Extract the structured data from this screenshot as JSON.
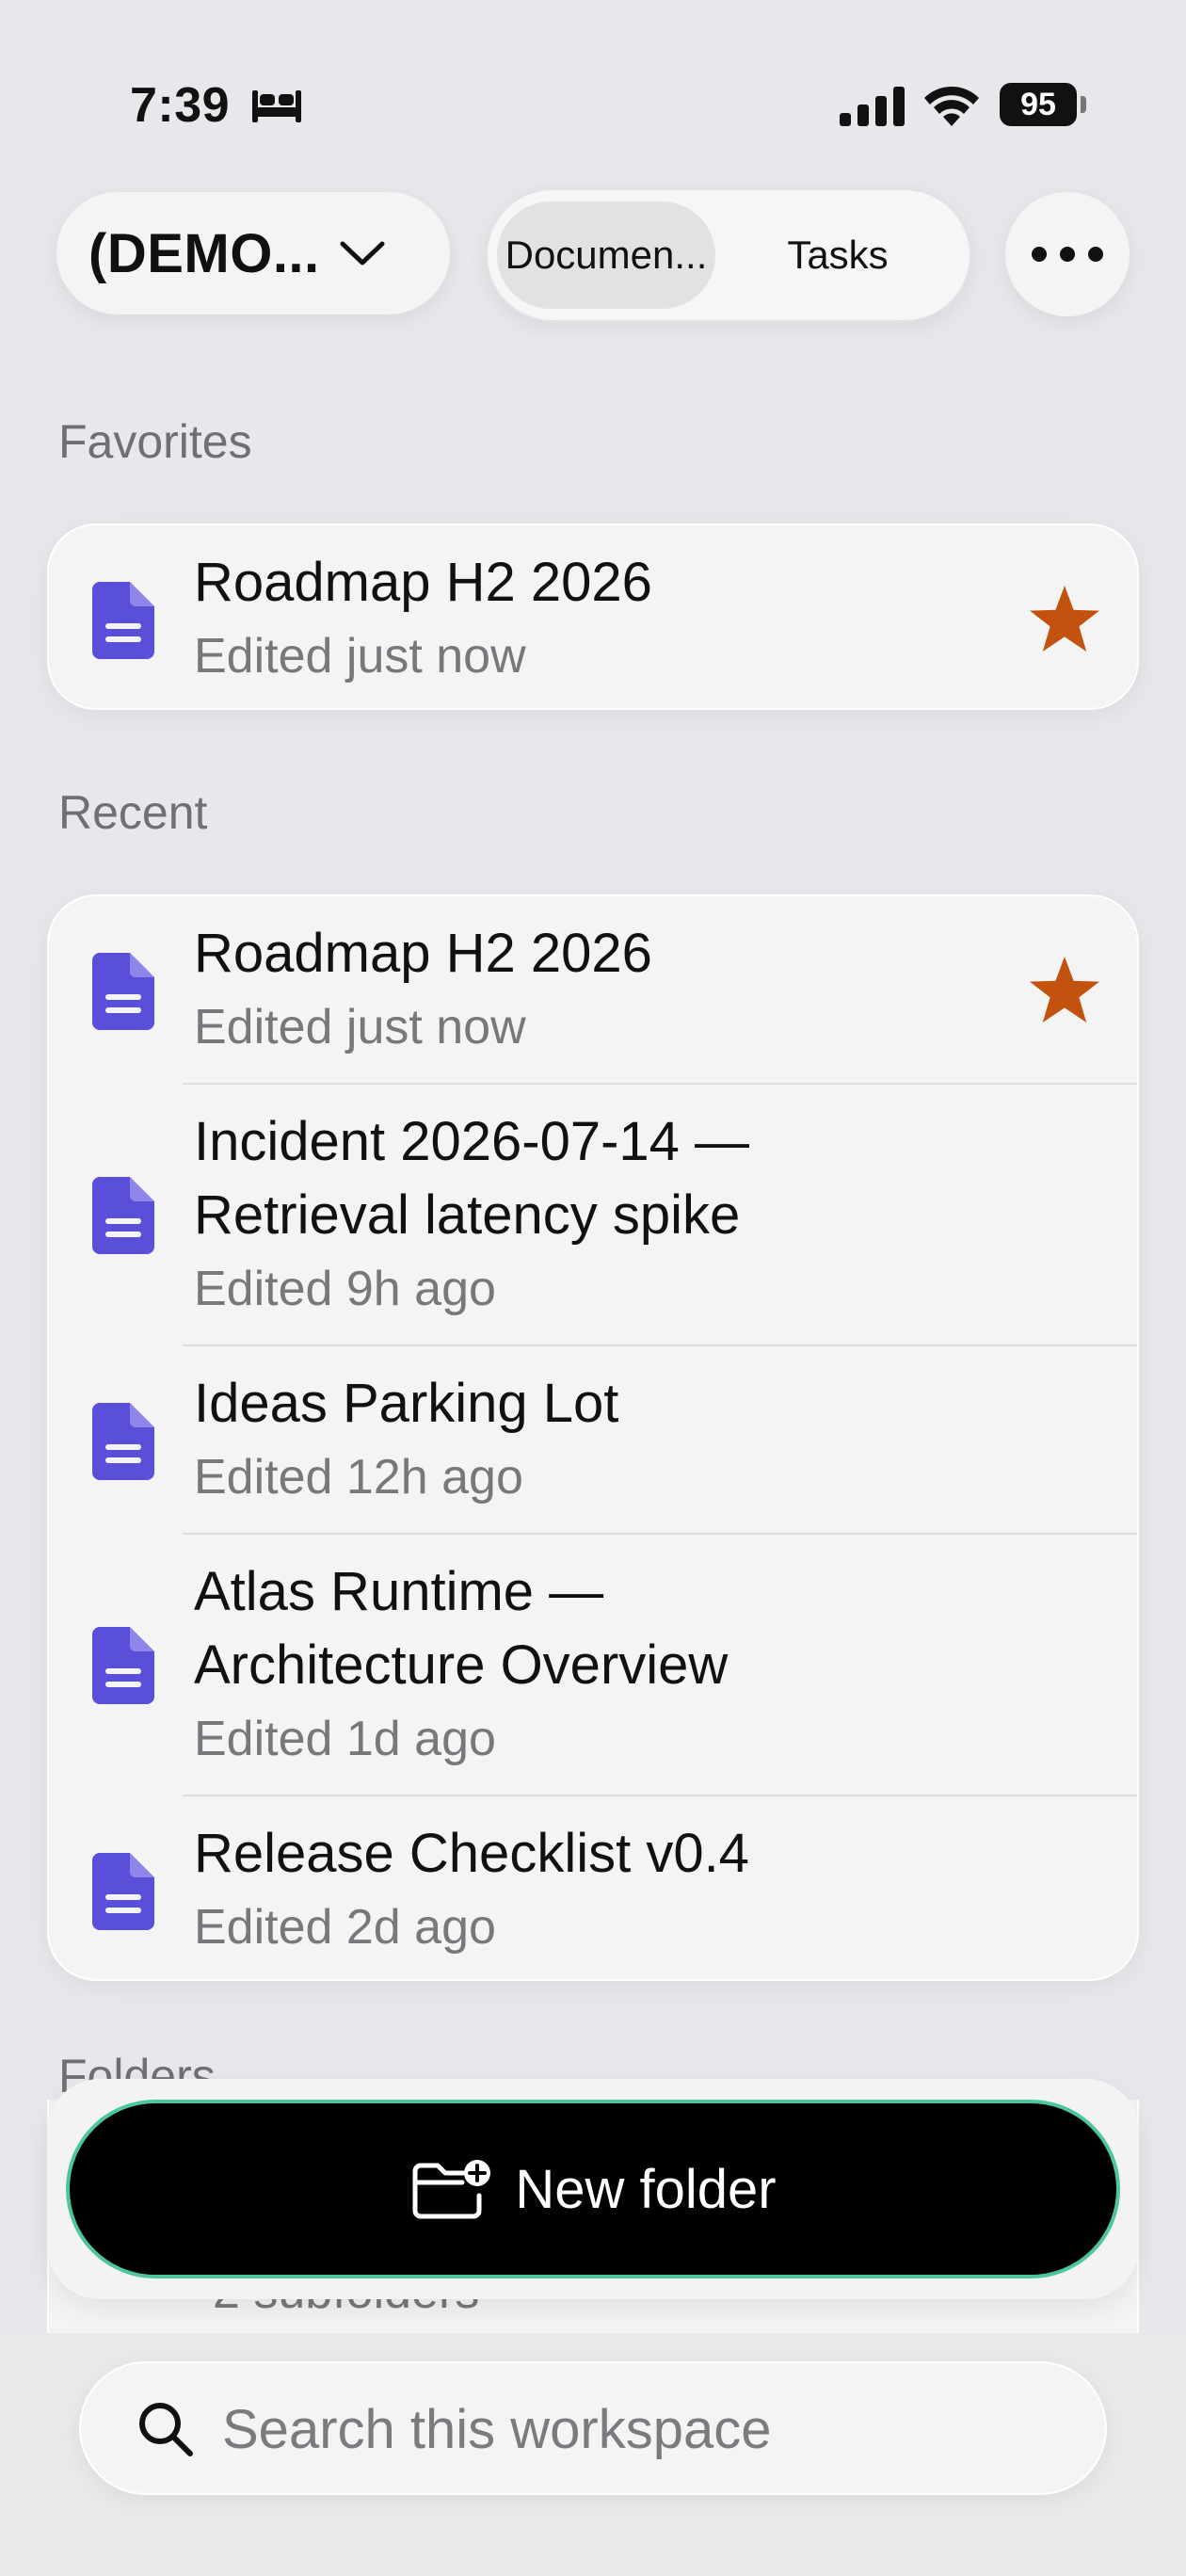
{
  "status_bar": {
    "time": "7:39",
    "battery": "95"
  },
  "header": {
    "workspace_name": "(DEMO...",
    "tabs": [
      {
        "label": "Documen...",
        "selected": true
      },
      {
        "label": "Tasks",
        "selected": false
      }
    ]
  },
  "favorites": {
    "title": "Favorites",
    "items": [
      {
        "title": "Roadmap H2 2026",
        "meta": "Edited just now",
        "starred": true
      }
    ]
  },
  "recent": {
    "title": "Recent",
    "items": [
      {
        "title": "Roadmap H2 2026",
        "meta": "Edited just now",
        "starred": true
      },
      {
        "title_line1": "Incident 2026-07-14 —",
        "title_line2": "Retrieval latency spike",
        "meta": "Edited 9h ago",
        "starred": false
      },
      {
        "title": "Ideas Parking Lot",
        "meta": "Edited 12h ago",
        "starred": false
      },
      {
        "title_line1": "Atlas Runtime —",
        "title_line2": "Architecture Overview",
        "meta": "Edited 1d ago",
        "starred": false
      },
      {
        "title": "Release Checklist v0.4",
        "meta": "Edited 2d ago",
        "starred": false
      }
    ]
  },
  "folders": {
    "title": "Folders",
    "peek_meta": "2 subfolders"
  },
  "actions": {
    "new_folder_label": "New folder"
  },
  "search": {
    "placeholder": "Search this workspace"
  },
  "colors": {
    "doc_icon": "#5a4fd8",
    "star": "#c4520f",
    "button_border": "#4cc79a"
  }
}
